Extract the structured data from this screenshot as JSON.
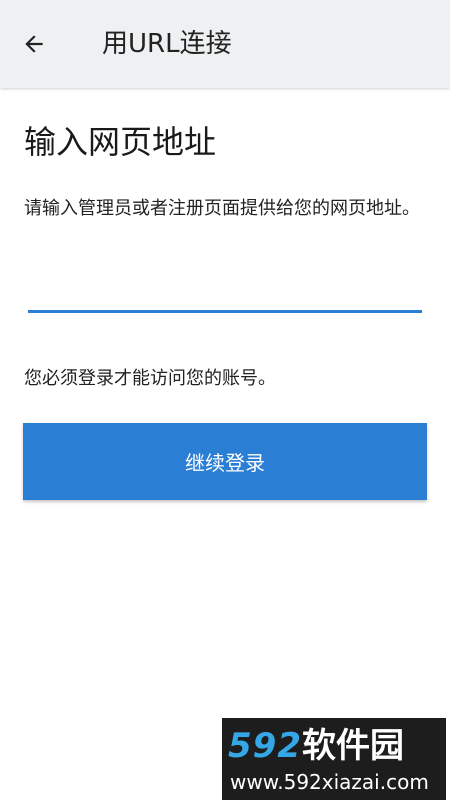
{
  "header": {
    "back_icon": "arrow-left-icon",
    "title": "用URL连接"
  },
  "main": {
    "title": "输入网页地址",
    "instruction": "请输入管理员或者注册页面提供给您的网页地址。",
    "url_input": {
      "value": "",
      "placeholder": ""
    },
    "login_note": "您必须登录才能访问您的账号。",
    "continue_label": "继续登录"
  },
  "watermark": {
    "number": "592",
    "brand": "软件园",
    "url": "www.592xiazai.com"
  },
  "colors": {
    "accent": "#2a7fd4",
    "header_bg": "#eef0f1",
    "watermark_number": "#35a7e6"
  }
}
